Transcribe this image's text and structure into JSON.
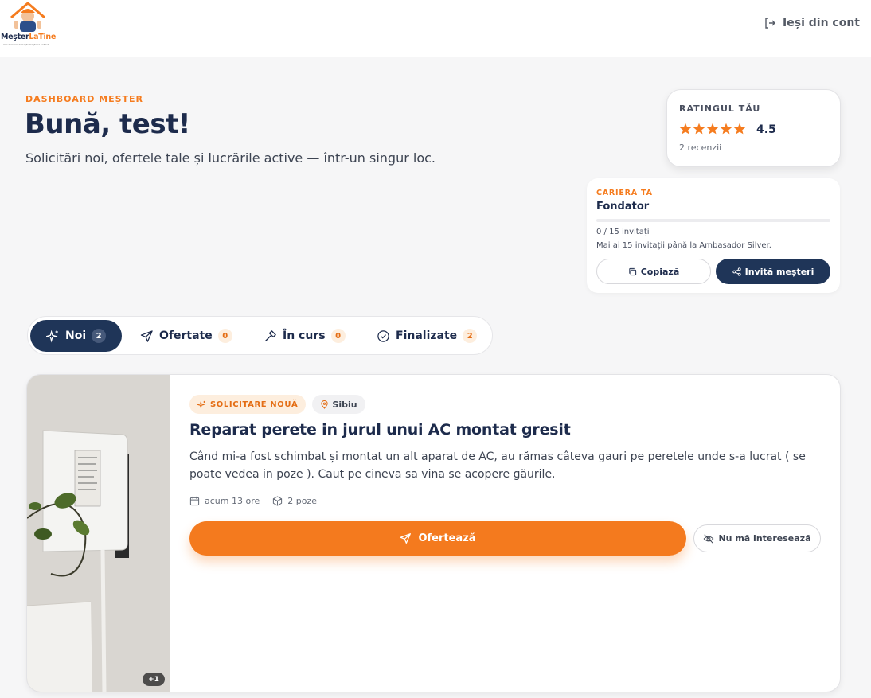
{
  "header": {
    "logo": {
      "brand_main": "Meşter",
      "brand_accent": "LaTine",
      "tagline": "Ai o lucrare? Găsește meșterul potrivit."
    },
    "logout_label": "Ieși din cont"
  },
  "hero": {
    "eyebrow": "DASHBOARD MEȘTER",
    "greeting": "Bună, test!",
    "subtitle": "Solicitări noi, ofertele tale și lucrările active — într-un singur loc."
  },
  "rating": {
    "title": "RATINGUL TĂU",
    "value": "4.5",
    "stars_filled": 5,
    "reviews": "2 recenzii"
  },
  "career": {
    "eyebrow": "CARIERA TA",
    "title": "Fondator",
    "progress_fraction": 0,
    "progress_text": "0 / 15 invitați",
    "hint": "Mai ai 15 invitații până la Ambasador Silver.",
    "copy_label": "Copiază",
    "invite_label": "Invită meșteri"
  },
  "tabs": [
    {
      "label": "Noi",
      "count": "2",
      "icon": "sparkles-icon"
    },
    {
      "label": "Ofertate",
      "count": "0",
      "icon": "send-icon"
    },
    {
      "label": "În curs",
      "count": "0",
      "icon": "hammer-icon"
    },
    {
      "label": "Finalizate",
      "count": "2",
      "icon": "check-circle-icon"
    }
  ],
  "request": {
    "badge": "SOLICITARE NOUĂ",
    "location": "Sibiu",
    "title": "Reparat perete in jurul unui AC montat gresit",
    "description": "Când mi-a fost schimbat și montat un alt aparat de AC, au rămas câteva gauri pe peretele unde s-a lucrat ( se poate vedea in poze ). Caut pe cineva sa vina se acopere găurile.",
    "posted": "acum 13 ore",
    "photos": "2 poze",
    "photo_extra": "+1",
    "offer_label": "Ofertează",
    "decline_label": "Nu mă interesează"
  },
  "colors": {
    "accent": "#f47a1e",
    "navy": "#1f3558",
    "background": "#f6f6f7"
  }
}
